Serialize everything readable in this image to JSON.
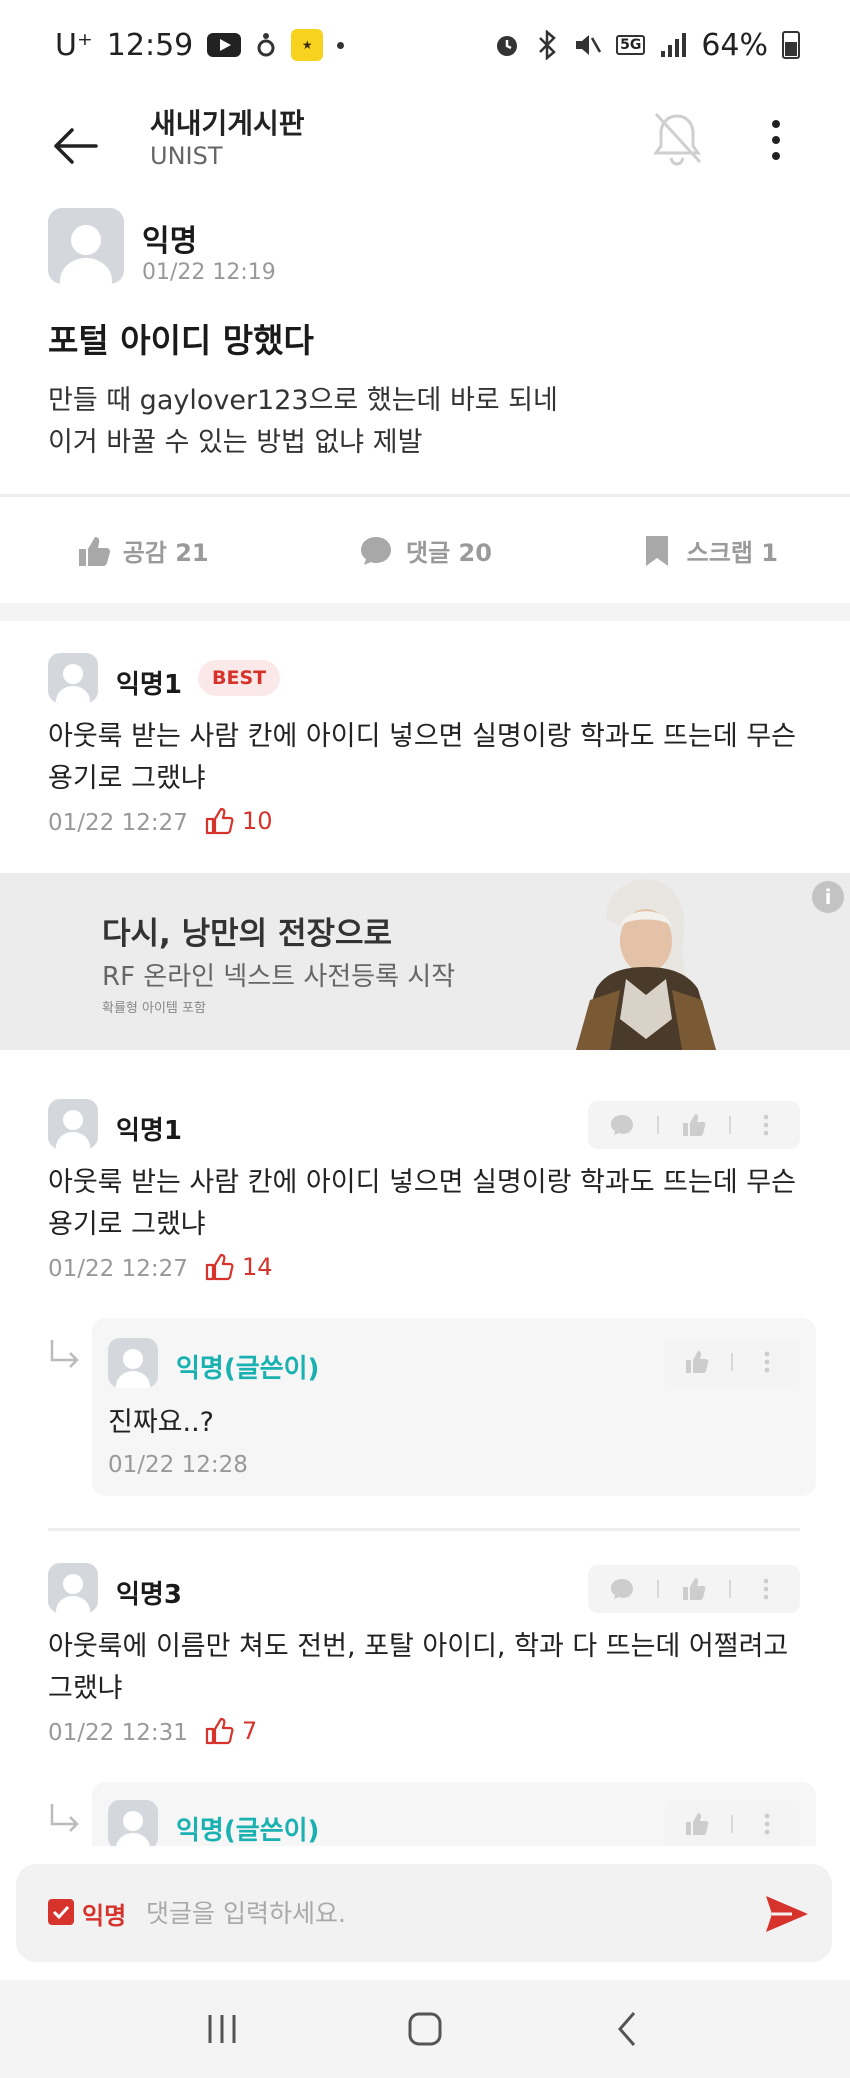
{
  "status_bar": {
    "carrier": "U⁺",
    "time": "12:59",
    "battery": "64%",
    "network": "5G"
  },
  "header": {
    "title": "새내기게시판",
    "subtitle": "UNIST"
  },
  "post": {
    "author": "익명",
    "time": "01/22 12:19",
    "title": "포털 아이디 망했다",
    "body_line1": "만들 때 gaylover123으로 했는데 바로 되네",
    "body_line2": "이거 바꿀 수 있는 방법 없냐 제발",
    "actions": {
      "like": "공감 21",
      "comment": "댓글 20",
      "scrap": "스크랩 1"
    }
  },
  "best_comment": {
    "author": "익명1",
    "badge": "BEST",
    "line1": "아웃룩 받는 사람 칸에 아이디 넣으면 실명이랑 학과도 뜨는데 무슨",
    "line2": "용기로 그랬냐",
    "time": "01/22 12:27",
    "likes": "10"
  },
  "ad": {
    "headline": "다시, 낭만의 전장으로",
    "sub": "RF 온라인 넥스트 사전등록 시작",
    "small": "확률형 아이템 포함",
    "info": "i"
  },
  "comments": [
    {
      "author": "익명1",
      "line1": "아웃룩 받는 사람 칸에 아이디 넣으면 실명이랑 학과도 뜨는데 무슨",
      "line2": "용기로 그랬냐",
      "time": "01/22 12:27",
      "likes": "14",
      "reply": {
        "author": "익명(글쓴이)",
        "body": "진짜요..?",
        "time": "01/22 12:28"
      }
    },
    {
      "author": "익명3",
      "line1": "아웃룩에 이름만 쳐도 전번, 포탈 아이디, 학과 다 뜨는데 어쩔려고",
      "line2": "그랬냐",
      "time": "01/22 12:31",
      "likes": "7",
      "reply": {
        "author": "익명(글쓴이)"
      }
    }
  ],
  "input_bar": {
    "anon_label": "익명",
    "placeholder": "댓글을 입력하세요."
  },
  "colors": {
    "accent_red": "#d6332c",
    "writer_teal": "#1ab1b1",
    "muted_gray": "#999999"
  },
  "icons": [
    "back-arrow-icon",
    "bell-off-icon",
    "more-vertical-icon",
    "thumbs-up-icon",
    "comment-bubble-icon",
    "bookmark-icon",
    "reply-arrow-icon",
    "send-icon",
    "recents-icon",
    "home-icon",
    "back-nav-icon"
  ]
}
